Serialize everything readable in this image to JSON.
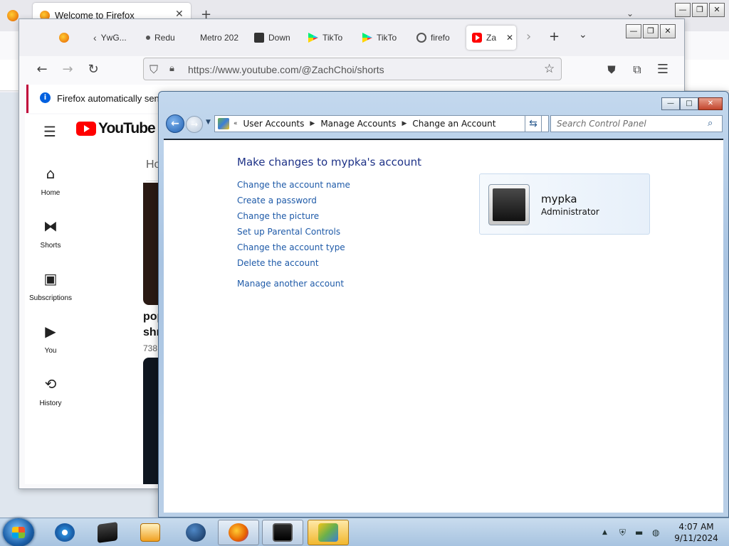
{
  "back_firefox": {
    "tab_title": "Welcome to Firefox",
    "close_symbol": "✕",
    "new_tab_symbol": "+",
    "list_all_symbol": "⌄",
    "window_buttons": [
      "—",
      "❐",
      "✕"
    ]
  },
  "firefox": {
    "tabs": [
      {
        "label": "",
        "icon": "firefox-icon"
      },
      {
        "label": "YwG...",
        "icon": "chevron-left-icon"
      },
      {
        "label": "Redu",
        "icon": "dot-icon"
      },
      {
        "label": "Metro 202",
        "icon": "none"
      },
      {
        "label": "Down",
        "icon": "download-icon"
      },
      {
        "label": "TikTo",
        "icon": "google-play-icon"
      },
      {
        "label": "TikTo",
        "icon": "google-play-icon"
      },
      {
        "label": "firefo",
        "icon": "firefox-ring-icon"
      }
    ],
    "active_tab": {
      "label": "Za",
      "icon": "youtube-icon",
      "close": "✕"
    },
    "new_tab_symbol": "+",
    "list_all_symbol": "⌄",
    "scroll_right_symbol": "›",
    "window_buttons": [
      "—",
      "❐",
      "✕"
    ],
    "url": "https://www.youtube.com/@ZachChoi/shorts",
    "notification": "Firefox automatically sends"
  },
  "youtube": {
    "logo_text": "YouTube",
    "nav": [
      {
        "label": "Home",
        "icon": "home-icon"
      },
      {
        "label": "Shorts",
        "icon": "shorts-icon"
      },
      {
        "label": "Subscriptions",
        "icon": "subscriptions-icon"
      },
      {
        "label": "You",
        "icon": "you-icon"
      },
      {
        "label": "History",
        "icon": "history-icon"
      }
    ],
    "tab_partial": "Ho",
    "video_title_line1": "pop",
    "video_title_line2": "shr",
    "video_views": "738"
  },
  "control_panel": {
    "breadcrumbs": [
      "User Accounts",
      "Manage Accounts",
      "Change an Account"
    ],
    "search_placeholder": "Search Control Panel",
    "heading": "Make changes to mypka's account",
    "tasks": [
      "Change the account name",
      "Create a password",
      "Change the picture",
      "Set up Parental Controls",
      "Change the account type",
      "Delete the account"
    ],
    "manage_another": "Manage another account",
    "account_name": "mypka",
    "account_role": "Administrator",
    "caption_buttons": [
      "—",
      "□",
      "✕"
    ]
  },
  "taskbar": {
    "items": [
      {
        "name": "internet-explorer",
        "icon": "ie-icon"
      },
      {
        "name": "black-box-app",
        "icon": "box-icon"
      },
      {
        "name": "media-app",
        "icon": "media-icon"
      },
      {
        "name": "globe-app",
        "icon": "globe-icon"
      },
      {
        "name": "firefox",
        "icon": "firefox-icon"
      },
      {
        "name": "monitor-app",
        "icon": "monitor-icon"
      },
      {
        "name": "control-panel",
        "icon": "control-panel-icon"
      }
    ],
    "time": "4:07 AM",
    "date": "9/11/2024"
  }
}
